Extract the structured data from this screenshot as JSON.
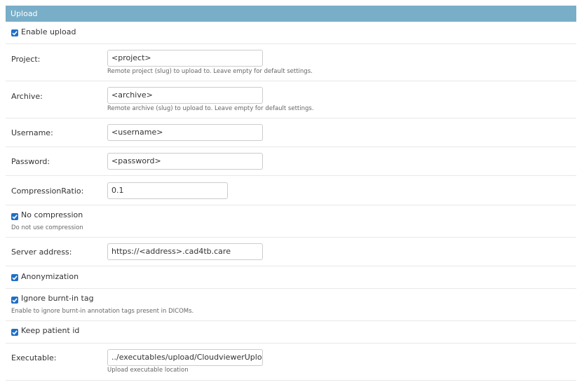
{
  "section": {
    "title": "Upload"
  },
  "enable_upload": {
    "label": "Enable upload",
    "checked": true
  },
  "project": {
    "label": "Project:",
    "value": "<project>",
    "help": "Remote project (slug) to upload to. Leave empty for default settings."
  },
  "archive": {
    "label": "Archive:",
    "value": "<archive>",
    "help": "Remote archive (slug) to upload to. Leave empty for default settings."
  },
  "username": {
    "label": "Username:",
    "value": "<username>"
  },
  "password": {
    "label": "Password:",
    "value": "<password>"
  },
  "compression_ratio": {
    "label": "CompressionRatio:",
    "value": "0.1"
  },
  "no_compression": {
    "label": "No compression",
    "checked": true,
    "help": "Do not use compression"
  },
  "server_address": {
    "label": "Server address:",
    "value": "https://<address>.cad4tb.care"
  },
  "anonymization": {
    "label": "Anonymization",
    "checked": true
  },
  "ignore_burnin": {
    "label": "Ignore burnt-in tag",
    "checked": true,
    "help": "Enable to ignore burnt-in annotation tags present in DICOMs."
  },
  "keep_patient_id": {
    "label": "Keep patient id",
    "checked": true
  },
  "executable": {
    "label": "Executable:",
    "value": "../executables/upload/CloudviewerUpload.exe",
    "help": "Upload executable location"
  },
  "colors": {
    "header_bg": "#79aec8",
    "checkbox": "#1f6fc6",
    "text": "#333333",
    "help": "#666666"
  }
}
